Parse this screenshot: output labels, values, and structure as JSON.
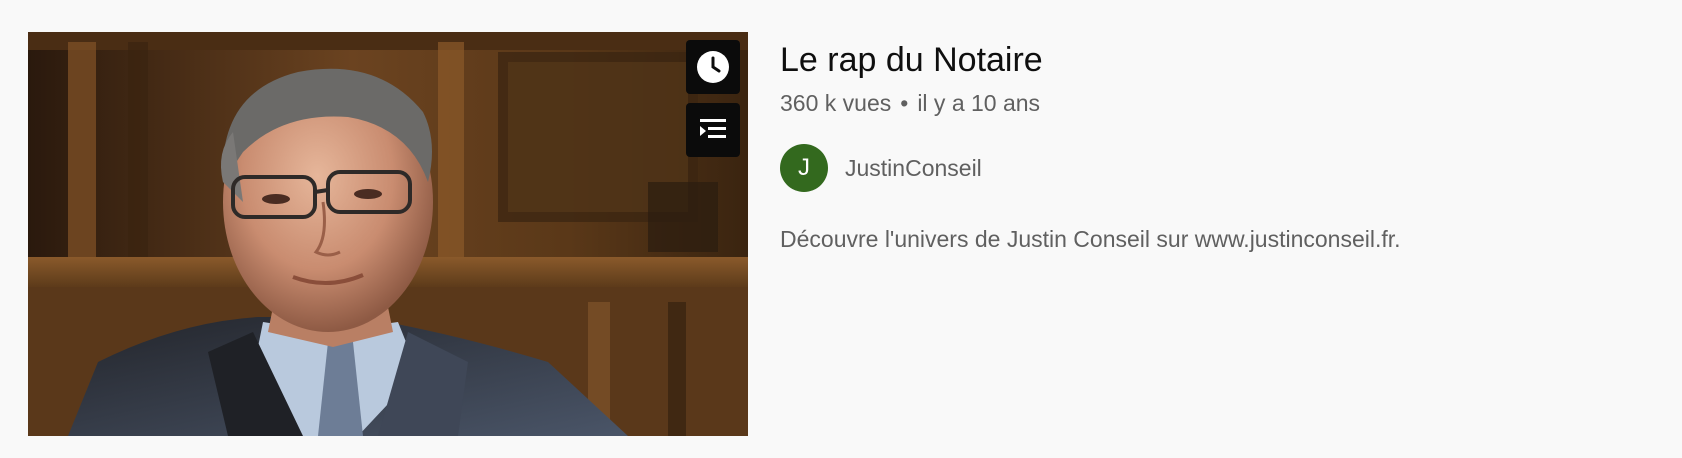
{
  "video": {
    "title": "Le rap du Notaire",
    "views": "360 k vues",
    "separator": "•",
    "age": "il y a 10 ans",
    "channel": {
      "name": "JustinConseil",
      "avatar_letter": "J",
      "avatar_color": "#33691e"
    },
    "description": "Découvre l'univers de Justin Conseil sur www.justinconseil.fr."
  },
  "thumbnail": {
    "subject": "video-thumbnail-man-in-suit",
    "hover_actions": [
      {
        "name": "watch-later",
        "icon": "clock-icon"
      },
      {
        "name": "add-to-queue",
        "icon": "queue-icon"
      }
    ]
  },
  "colors": {
    "background": "#f9f9f9",
    "title": "#0f0f0f",
    "secondary_text": "#606060",
    "overlay_button": "#0b0b0b"
  }
}
